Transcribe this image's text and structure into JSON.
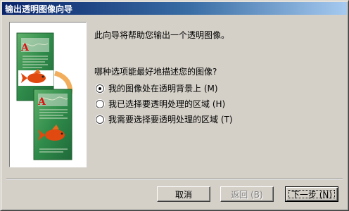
{
  "window": {
    "title": "输出透明图像向导"
  },
  "intro": "此向导将帮助您输出一个透明图像。",
  "question": "哪种选项能最好地描述您的图像?",
  "options": [
    {
      "label": "我的图像处在透明背景上 (M)",
      "selected": true
    },
    {
      "label": "我已选择要透明处理的区域 (H)",
      "selected": false
    },
    {
      "label": "我需要选择要透明处理的区域 (T)",
      "selected": false
    }
  ],
  "buttons": {
    "cancel": "取消",
    "back": "返回 (B)",
    "next": "下一步 (N)"
  },
  "illustration": {
    "letter": "A"
  },
  "colors": {
    "title_bar": "#0a246a",
    "dialog_face": "#d4d0c8",
    "disabled_text": "#808080"
  }
}
